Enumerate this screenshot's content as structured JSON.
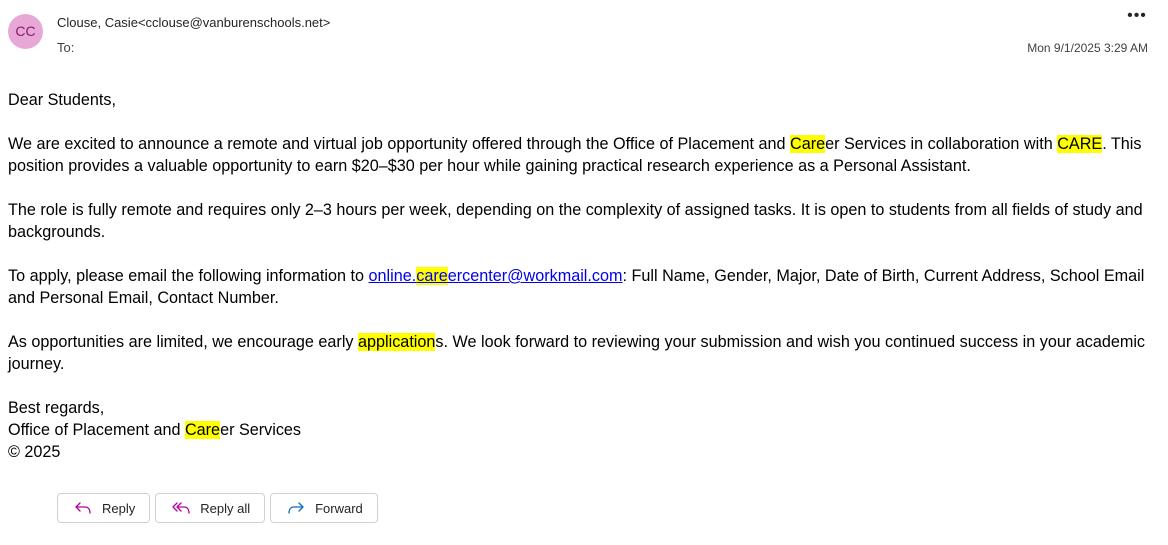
{
  "header": {
    "avatar_initials": "CC",
    "sender_name": "Clouse, Casie",
    "sender_email": "<cclouse@vanburenschools.net>",
    "to_label": "To:",
    "date": "Mon 9/1/2025 3:29 AM",
    "more_icon": "more-horizontal-icon"
  },
  "body": {
    "greeting": "Dear Students,",
    "p1": {
      "a": "We are excited to announce a remote and virtual job opportunity offered through the Office of Placement and ",
      "hl1": "Care",
      "b": "er Services in collaboration with ",
      "hl2": "CARE",
      "c": ". This position provides a valuable opportunity to earn $20–$30 per hour while gaining practical research experience as a Personal Assistant."
    },
    "p2": "The role is fully remote and requires only 2–3 hours per week, depending on the complexity of assigned tasks. It is open to students from all fields of study and backgrounds.",
    "p3": {
      "a": "To apply, please email the following information to ",
      "link_pre": "online.",
      "link_hl": "care",
      "link_post": "ercenter@workmail.com",
      "b": ": Full Name, Gender, Major, Date of Birth, Current Address, School Email and Personal Email, Contact Number."
    },
    "p4": {
      "a": "As opportunities are limited, we encourage early ",
      "hl": "application",
      "b": "s. We look forward to reviewing your submission and wish you continued success in your academic journey."
    },
    "closing": "Best regards,",
    "sig": {
      "a": "Office of Placement and ",
      "hl": "Care",
      "b": "er Services"
    },
    "copyright": "© 2025"
  },
  "actions": {
    "reply": "Reply",
    "reply_all": "Reply all",
    "forward": "Forward"
  },
  "colors": {
    "avatar_bg": "#e7a8d8",
    "highlight": "#ffff00",
    "link": "#0000ee",
    "reply_icon": "#b4009e",
    "forward_icon": "#0f6cbd"
  }
}
